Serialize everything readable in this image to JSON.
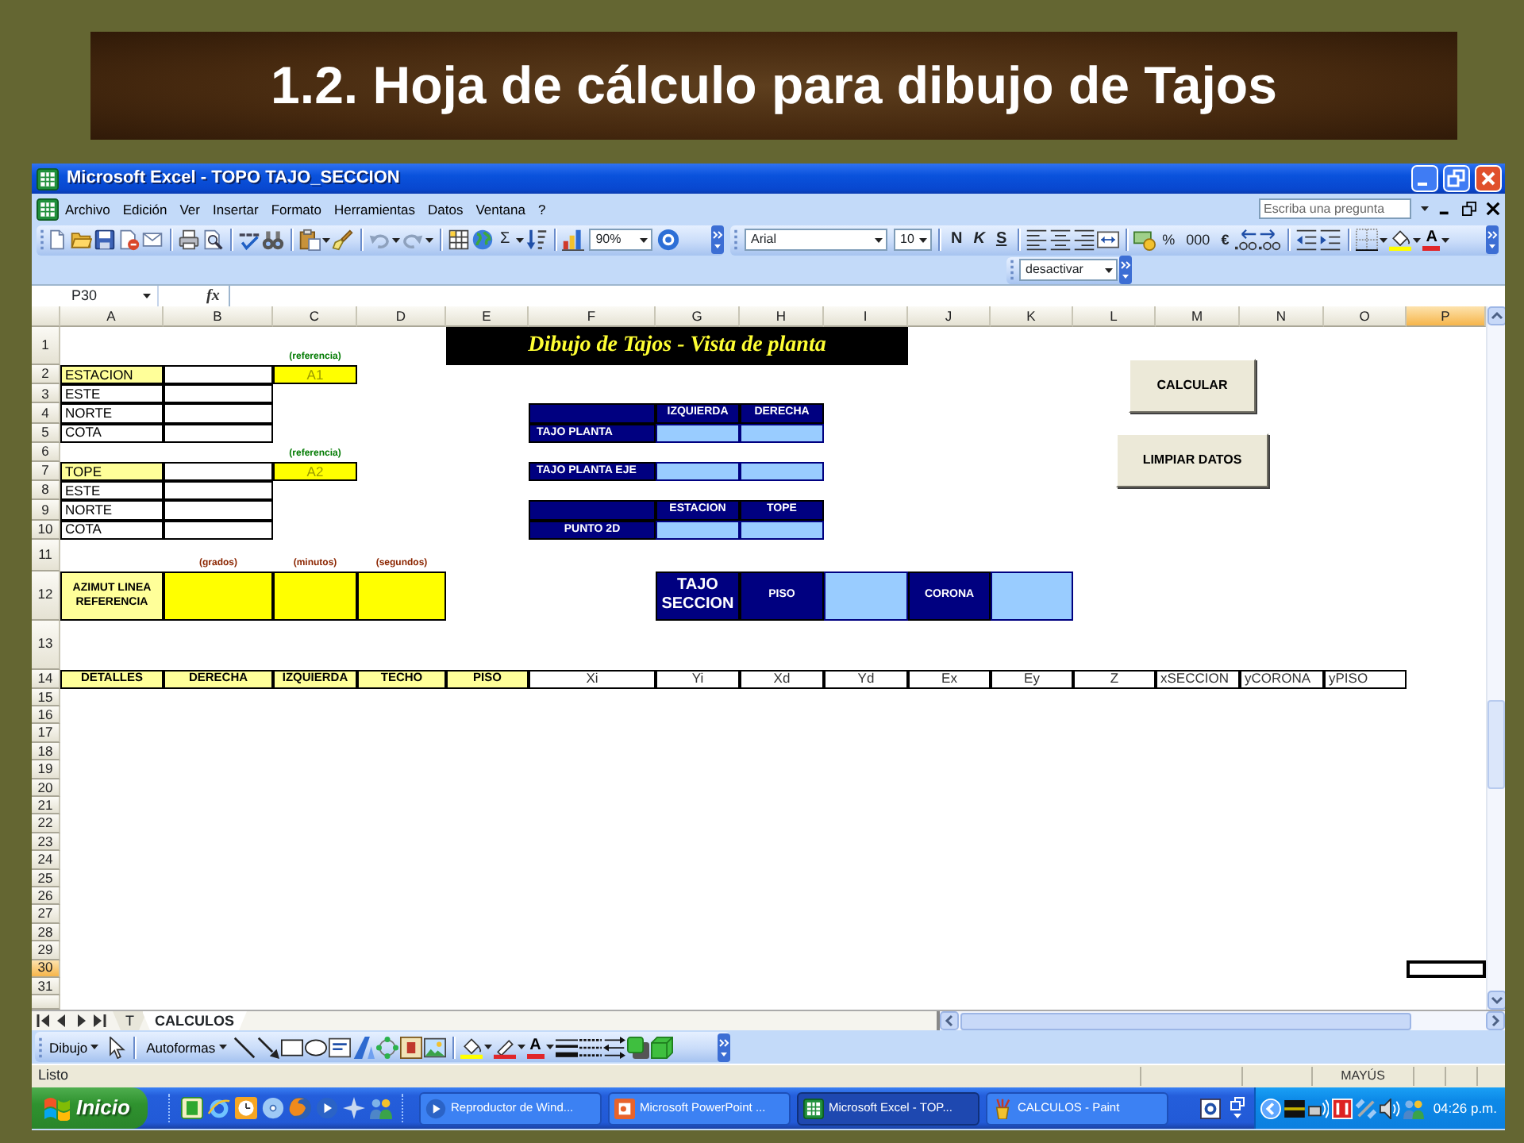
{
  "slide": {
    "title": "1.2. Hoja de cálculo para dibujo de Tajos"
  },
  "window": {
    "title": "Microsoft Excel - TOPO TAJO_SECCION"
  },
  "menu": [
    "Archivo",
    "Edición",
    "Ver",
    "Insertar",
    "Formato",
    "Herramientas",
    "Datos",
    "Ventana",
    "?"
  ],
  "help_box": {
    "placeholder": "Escriba una pregunta"
  },
  "standard_toolbar": {
    "autosum": "Σ",
    "zoom": "90%"
  },
  "formatting_toolbar": {
    "font": "Arial",
    "size": "10",
    "bold": "N",
    "italic": "K",
    "underline": "S",
    "percent": "%",
    "thousands": "000",
    "euro": "€",
    "font_color": "A"
  },
  "macro_toolbar": {
    "selection": "desactivar"
  },
  "formula_bar": {
    "name_box": "P30",
    "function_label": "fx"
  },
  "sheet": {
    "columns": [
      {
        "label": "A",
        "selected": false
      },
      {
        "label": "B",
        "selected": false
      },
      {
        "label": "C",
        "selected": false
      },
      {
        "label": "D",
        "selected": false
      },
      {
        "label": "E",
        "selected": false
      },
      {
        "label": "F",
        "selected": false
      },
      {
        "label": "G",
        "selected": false
      },
      {
        "label": "H",
        "selected": false
      },
      {
        "label": "I",
        "selected": false
      },
      {
        "label": "J",
        "selected": false
      },
      {
        "label": "K",
        "selected": false
      },
      {
        "label": "L",
        "selected": false
      },
      {
        "label": "M",
        "selected": false
      },
      {
        "label": "N",
        "selected": false
      },
      {
        "label": "O",
        "selected": false
      },
      {
        "label": "P",
        "selected": true
      }
    ],
    "rows": [
      {
        "label": "1",
        "selected": false
      },
      {
        "label": "2",
        "selected": false
      },
      {
        "label": "3",
        "selected": false
      },
      {
        "label": "4",
        "selected": false
      },
      {
        "label": "5",
        "selected": false
      },
      {
        "label": "6",
        "selected": false
      },
      {
        "label": "7",
        "selected": false
      },
      {
        "label": "8",
        "selected": false
      },
      {
        "label": "9",
        "selected": false
      },
      {
        "label": "10",
        "selected": false
      },
      {
        "label": "11",
        "selected": false
      },
      {
        "label": "12",
        "selected": false
      },
      {
        "label": "13",
        "selected": false
      },
      {
        "label": "14",
        "selected": false
      },
      {
        "label": "15",
        "selected": false
      },
      {
        "label": "16",
        "selected": false
      },
      {
        "label": "17",
        "selected": false
      },
      {
        "label": "18",
        "selected": false
      },
      {
        "label": "19",
        "selected": false
      },
      {
        "label": "20",
        "selected": false
      },
      {
        "label": "21",
        "selected": false
      },
      {
        "label": "22",
        "selected": false
      },
      {
        "label": "23",
        "selected": false
      },
      {
        "label": "24",
        "selected": false
      },
      {
        "label": "25",
        "selected": false
      },
      {
        "label": "26",
        "selected": false
      },
      {
        "label": "27",
        "selected": false
      },
      {
        "label": "28",
        "selected": false
      },
      {
        "label": "29",
        "selected": false
      },
      {
        "label": "30",
        "selected": true
      },
      {
        "label": "31",
        "selected": false
      }
    ],
    "title_banner": "Dibujo de Tajos - Vista de planta",
    "reference_groups": [
      {
        "note": "(referencia)",
        "name": "ESTACION",
        "reference": "A1",
        "fields": [
          "ESTE",
          "NORTE",
          "COTA"
        ]
      },
      {
        "note": "(referencia)",
        "name": "TOPE",
        "reference": "A2",
        "fields": [
          "ESTE",
          "NORTE",
          "COTA"
        ]
      }
    ],
    "plan_tables": [
      {
        "columns": [
          "IZQUIERDA",
          "DERECHA"
        ],
        "rows": [
          "TAJO PLANTA"
        ]
      },
      {
        "rows": [
          "TAJO PLANTA EJE"
        ]
      },
      {
        "columns": [
          "ESTACION",
          "TOPE"
        ],
        "rows": [
          "PUNTO 2D"
        ]
      }
    ],
    "azimuth": {
      "label": "AZIMUT LINEA REFERENCIA",
      "units": [
        "(grados)",
        "(minutos)",
        "(segundos)"
      ]
    },
    "section_table": {
      "title": "TAJO SECCION",
      "fields": [
        "PISO",
        "CORONA"
      ]
    },
    "detail_header": {
      "labels": [
        "DETALLES",
        "DERECHA",
        "IZQUIERDA",
        "TECHO",
        "PISO"
      ],
      "coordinates": [
        "Xi",
        "Yi",
        "Xd",
        "Yd",
        "Ex",
        "Ey",
        "Z"
      ],
      "outputs": [
        "xSECCION",
        "yCORONA",
        "yPISO"
      ]
    },
    "buttons": [
      "CALCULAR",
      "LIMPIAR DATOS"
    ]
  },
  "sheet_tabs": [
    {
      "label": "T",
      "selected": false
    },
    {
      "label": "CALCULOS",
      "selected": true
    }
  ],
  "drawing_toolbar": {
    "draw_menu": "Dibujo",
    "autoshapes_menu": "Autoformas",
    "font_color": "A"
  },
  "status_bar": {
    "message": "Listo",
    "indicators": [
      "MAYÚS"
    ]
  },
  "taskbar": {
    "start": "Inicio",
    "tasks": [
      {
        "label": "Reproductor de Wind...",
        "selected": false
      },
      {
        "label": "Microsoft PowerPoint ...",
        "selected": false
      },
      {
        "label": "Microsoft Excel - TOP...",
        "selected": true
      },
      {
        "label": "CALCULOS - Paint",
        "selected": false
      }
    ],
    "clock": "04:26 p.m."
  }
}
